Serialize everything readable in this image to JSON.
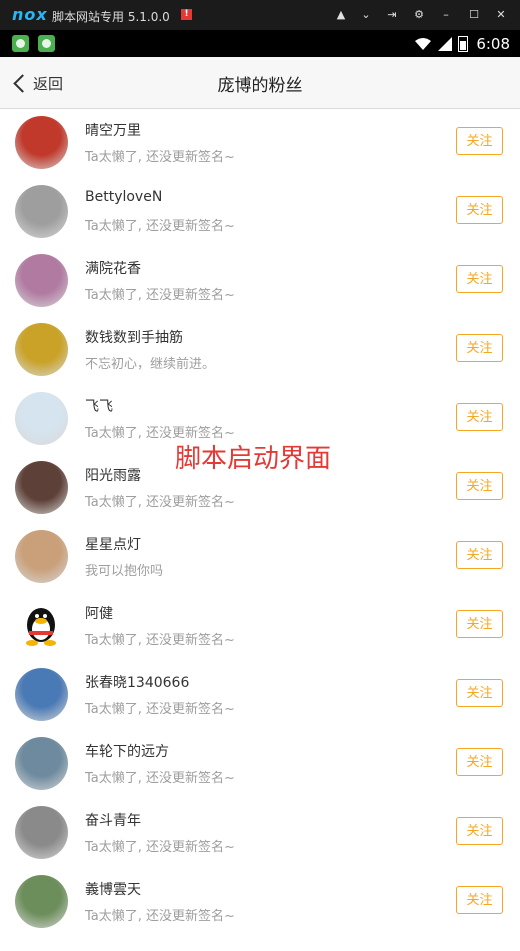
{
  "emulator": {
    "logo": "nox",
    "title": "脚本网站专用 5.1.0.0",
    "badge": "!"
  },
  "status_bar": {
    "time": "6:08"
  },
  "header": {
    "back_label": "返回",
    "title": "庞博的粉丝"
  },
  "follow_label": "关注",
  "overlay_text": "脚本启动界面",
  "fans": [
    {
      "name": "晴空万里",
      "signature": "Ta太懒了, 还没更新签名~",
      "avatar_color": "#c0392b"
    },
    {
      "name": "BettyloveN",
      "signature": "Ta太懒了, 还没更新签名~",
      "avatar_color": "#9e9e9e"
    },
    {
      "name": "满院花香",
      "signature": "Ta太懒了, 还没更新签名~",
      "avatar_color": "#b07aa1"
    },
    {
      "name": "数钱数到手抽筋",
      "signature": "不忘初心，继续前进。",
      "avatar_color": "#c9a227"
    },
    {
      "name": "飞飞",
      "signature": "Ta太懒了, 还没更新签名~",
      "avatar_color": "#d6e4ef"
    },
    {
      "name": "阳光雨露",
      "signature": "Ta太懒了, 还没更新签名~",
      "avatar_color": "#5d4037"
    },
    {
      "name": "星星点灯",
      "signature": "我可以抱你吗",
      "avatar_color": "#c9a07a"
    },
    {
      "name": "阿健",
      "signature": "Ta太懒了, 还没更新签名~",
      "avatar_color": "#ffffff"
    },
    {
      "name": "张春晓1340666",
      "signature": "Ta太懒了, 还没更新签名~",
      "avatar_color": "#4a7ab5"
    },
    {
      "name": "车轮下的远方",
      "signature": "Ta太懒了, 还没更新签名~",
      "avatar_color": "#6d8a9e"
    },
    {
      "name": "奋斗青年",
      "signature": "Ta太懒了, 还没更新签名~",
      "avatar_color": "#8a8a8a"
    },
    {
      "name": "義博雲天",
      "signature": "Ta太懒了, 还没更新签名~",
      "avatar_color": "#6b8e5a"
    }
  ]
}
